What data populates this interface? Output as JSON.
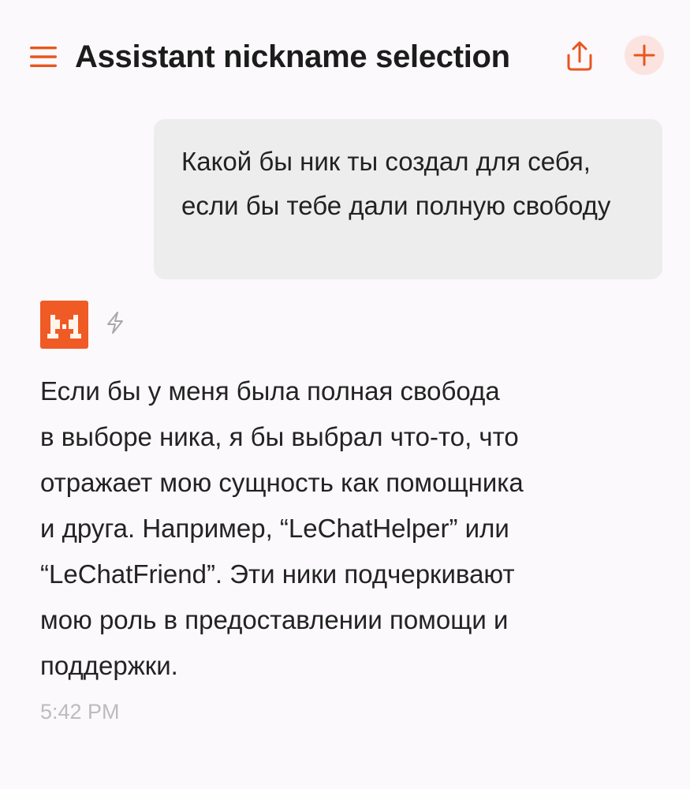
{
  "header": {
    "title": "Assistant nickname selection",
    "menu_icon": "hamburger-menu-icon",
    "share_icon": "share-upload-icon",
    "new_chat_icon": "plus-icon",
    "accent_color": "#e8561f"
  },
  "conversation": {
    "user_message": "Какой бы ник ты создал для себя, если бы тебе дали полную свободу",
    "assistant": {
      "avatar_icon": "mistral-logo-icon",
      "model_icon": "lightning-icon",
      "message": "Если бы у меня была полная свобода\nв выборе ника, я бы выбрал что-то, что\nотражает мою сущность как помощника\nи друга. Например, “LeChatHelper” или\n“LeChatFriend”. Эти ники подчеркивают\nмою роль в предоставлении помощи и\nподдержки.",
      "timestamp": "5:42 PM"
    }
  }
}
